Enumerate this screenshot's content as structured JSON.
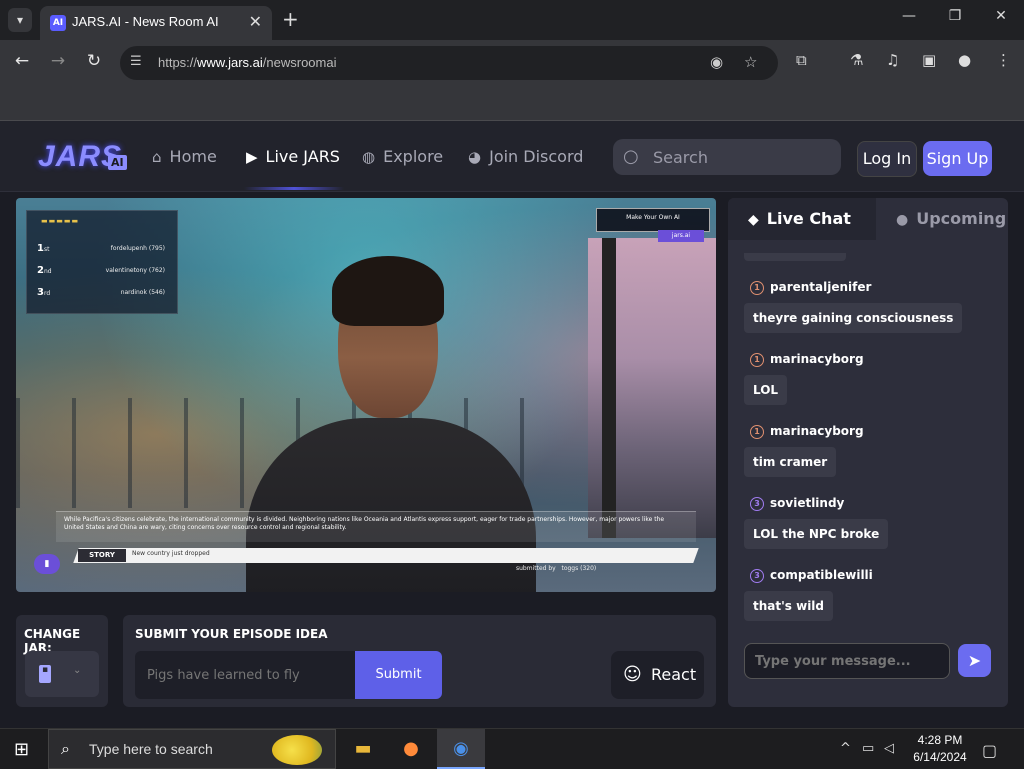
{
  "browser": {
    "tab_title": "JARS.AI - News Room AI",
    "url_prefix": "https://",
    "url_domain": "www.jars.ai",
    "url_path": "/newsroomai"
  },
  "site": {
    "logo_text": "JARS",
    "logo_badge": "AI",
    "nav": [
      {
        "label": "Home",
        "icon": "home-icon"
      },
      {
        "label": "Live JARS",
        "icon": "tv-icon"
      },
      {
        "label": "Explore",
        "icon": "globe-icon"
      },
      {
        "label": "Join Discord",
        "icon": "discord-icon"
      }
    ],
    "search_placeholder": "Search",
    "login_label": "Log In",
    "signup_label": "Sign Up"
  },
  "video": {
    "leaderboard": [
      {
        "rank": "1",
        "suffix": "st",
        "name": "fordelupenh (795)"
      },
      {
        "rank": "2",
        "suffix": "nd",
        "name": "valentinetony (762)"
      },
      {
        "rank": "3",
        "suffix": "rd",
        "name": "nardinok (546)"
      }
    ],
    "make_your_own": "Make Your Own AI",
    "jars_chip": "jars.ai",
    "ticker_text": "While Pacifica's citizens celebrate, the international community is divided. Neighboring nations like Oceania and Atlantis express support, eager for trade partnerships. However, major powers like the United States and China are wary, citing concerns over resource control and regional stability.",
    "story_label": "STORY",
    "story_text": "New country just dropped",
    "submitted_label": "submitted by",
    "submitted_user": "toggs (320)"
  },
  "controls": {
    "change_jar_label": "CHANGE JAR:",
    "submit_title": "SUBMIT YOUR EPISODE IDEA",
    "idea_placeholder": "Pigs have learned to fly",
    "submit_label": "Submit",
    "react_label": "React"
  },
  "chat": {
    "tab_live": "Live Chat",
    "tab_upcoming": "Upcoming",
    "messages": [
      {
        "level": "1",
        "user": "parentaljenifer",
        "text": "theyre gaining consciousness"
      },
      {
        "level": "1",
        "user": "marinacyborg",
        "text": "LOL"
      },
      {
        "level": "1",
        "user": "marinacyborg",
        "text": "tim cramer"
      },
      {
        "level": "3",
        "user": "sovietlindy",
        "text": "LOL the NPC broke"
      },
      {
        "level": "3",
        "user": "compatiblewilli",
        "text": "that's wild"
      }
    ],
    "input_placeholder": "Type your message..."
  },
  "taskbar": {
    "search_placeholder": "Type here to search",
    "time": "4:28 PM",
    "date": "6/14/2024"
  },
  "colors": {
    "accent": "#6b6cf0",
    "bg": "#1b1c24",
    "panel": "#2a2b36"
  }
}
